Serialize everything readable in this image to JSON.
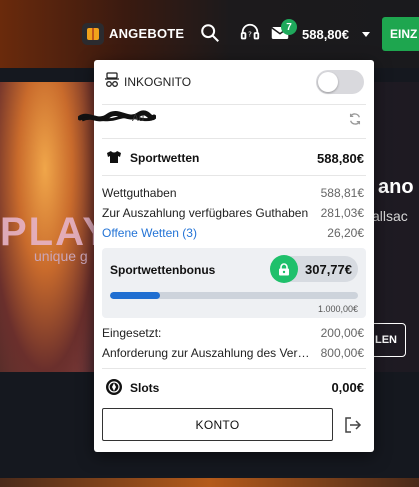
{
  "header": {
    "offers_label": "ANGEBOTE",
    "mail_count": "7",
    "balance": "588,80€",
    "deposit_label": "EINZ",
    "icons": [
      "gift-icon",
      "search-icon",
      "support-icon",
      "mail-icon",
      "chevron-down-icon"
    ]
  },
  "hero": {
    "brand_partial": "PLAY",
    "tagline_partial": "unique g",
    "title_partial": "ano",
    "subtitle_partial": "allsac",
    "button_partial": "LEN"
  },
  "panel": {
    "incognito_label": "INKOGNITO",
    "incognito_on": false,
    "username_partial": "Au",
    "sportwetten": {
      "label": "Sportwetten",
      "value": "588,80€"
    },
    "lines": [
      {
        "label": "Wettguthaben",
        "value": "588,81€"
      },
      {
        "label": "Zur Auszahlung verfügbares Guthaben",
        "value": "281,03€"
      },
      {
        "label": "Offene Wetten (3)",
        "value": "26,20€"
      }
    ],
    "bonus": {
      "label": "Sportwettenbonus",
      "value": "307,77€",
      "target": "1.000,00€",
      "progress_fraction": 0.2
    },
    "wager_lines": [
      {
        "label": "Eingesetzt:",
        "value": "200,00€"
      },
      {
        "label": "Anforderung zur Auszahlung des Verb…",
        "value": "800,00€"
      }
    ],
    "slots": {
      "label": "Slots",
      "value": "0,00€"
    },
    "konto_label": "KONTO"
  },
  "colors": {
    "accent_green": "#1ea64f",
    "link_blue": "#2474d6",
    "progress_blue": "#1f6ed1"
  }
}
